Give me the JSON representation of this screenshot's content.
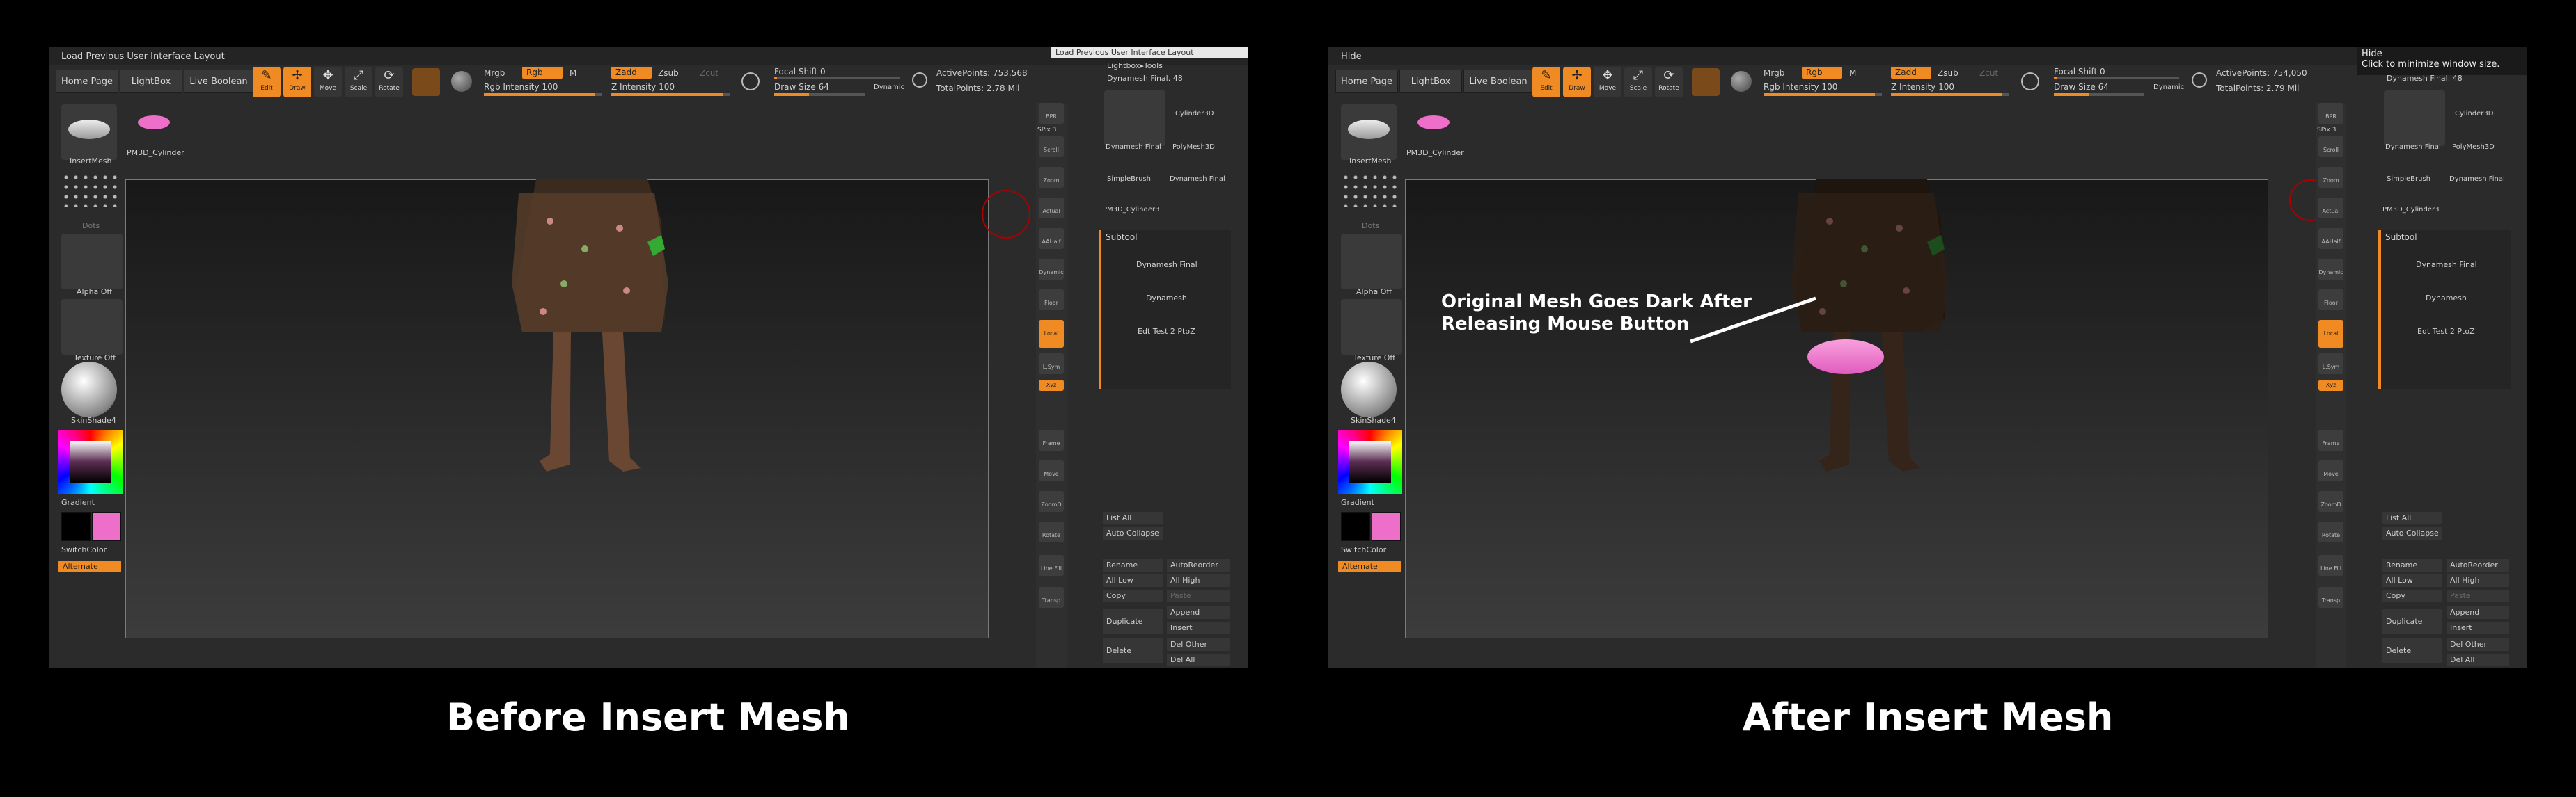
{
  "captions": {
    "before": "Before Insert Mesh",
    "after": "After Insert Mesh"
  },
  "annotation": {
    "line1": "Original Mesh Goes Dark After",
    "line2": "Releasing Mouse Button"
  },
  "before": {
    "menu_text": "Load Previous User Interface Layout",
    "popup_text": "Load Previous User Interface Layout",
    "tabs": [
      "Home Page",
      "LightBox",
      "Live Boolean"
    ],
    "tools": [
      "Edit",
      "Draw",
      "Move",
      "Scale",
      "Rotate"
    ],
    "mrgb": "Mrgb",
    "rgb": "Rgb",
    "m": "M",
    "zadd": "Zadd",
    "zsub": "Zsub",
    "zcut": "Zcut",
    "rgb_intensity": "Rgb Intensity 100",
    "z_intensity": "Z Intensity 100",
    "focal_shift": "Focal Shift 0",
    "draw_size": "Draw Size 64",
    "dynamic": "Dynamic",
    "active_points": "ActivePoints: 753,568",
    "total_points": "TotalPoints: 2.78 Mil",
    "insertmesh_label": "InsertMesh",
    "cylinder_label": "PM3D_Cylinder",
    "dots_label": "Dots",
    "alpha_off": "Alpha Off",
    "texture_off": "Texture Off",
    "material": "SkinShade4",
    "gradient": "Gradient",
    "switchcolor": "SwitchColor",
    "alternate": "Alternate",
    "lightbox_tools": "Lightbox▸Tools",
    "dynamesh_final_48": "Dynamesh Final. 48",
    "tool_thumbs": [
      "Dynamesh Final",
      "Cylinder3D",
      "PolyMesh3D",
      "SimpleBrush",
      "Dynamesh Final",
      "PM3D_Cylinder3"
    ],
    "subtool_title": "Subtool",
    "subtools": [
      "Dynamesh Final",
      "Dynamesh",
      "Edt Test 2 PtoZ"
    ],
    "list_all": "List All",
    "auto_collapse": "Auto Collapse",
    "buttons": [
      "Rename",
      "AutoReorder",
      "All Low",
      "All High",
      "Copy",
      "Paste",
      "Duplicate",
      "Append",
      "Insert",
      "Delete",
      "Del Other",
      "Del All"
    ],
    "spix": "SPix 3",
    "strip": [
      "BPR",
      "Scroll",
      "Zoom",
      "Actual",
      "AAHalf",
      "Dynamic Persp",
      "Floor",
      "Local",
      "L.Sym",
      "Xyz",
      "Frame",
      "Move",
      "ZoomD",
      "Rotate",
      "Line Fill PolyF",
      "Transp"
    ]
  },
  "after": {
    "menu_text": "Hide",
    "popup_title": "Hide",
    "popup_text": "Click to minimize window size.",
    "tabs": [
      "Home Page",
      "LightBox",
      "Live Boolean"
    ],
    "tools": [
      "Edit",
      "Draw",
      "Move",
      "Scale",
      "Rotate"
    ],
    "mrgb": "Mrgb",
    "rgb": "Rgb",
    "m": "M",
    "zadd": "Zadd",
    "zsub": "Zsub",
    "zcut": "Zcut",
    "rgb_intensity": "Rgb Intensity 100",
    "z_intensity": "Z Intensity 100",
    "focal_shift": "Focal Shift 0",
    "draw_size": "Draw Size 64",
    "dynamic": "Dynamic",
    "active_points": "ActivePoints: 754,050",
    "total_points": "TotalPoints: 2.79 Mil",
    "insertmesh_label": "InsertMesh",
    "cylinder_label": "PM3D_Cylinder",
    "dots_label": "Dots",
    "alpha_off": "Alpha Off",
    "texture_off": "Texture Off",
    "material": "SkinShade4",
    "gradient": "Gradient",
    "switchcolor": "SwitchColor",
    "alternate": "Alternate",
    "dynamesh_final_48": "Dynamesh Final. 48",
    "tool_thumbs": [
      "Dynamesh Final",
      "Cylinder3D",
      "PolyMesh3D",
      "SimpleBrush",
      "Dynamesh Final",
      "PM3D_Cylinder3"
    ],
    "subtool_title": "Subtool",
    "subtools": [
      "Dynamesh Final",
      "Dynamesh",
      "Edt Test 2 PtoZ"
    ],
    "list_all": "List All",
    "auto_collapse": "Auto Collapse",
    "buttons": [
      "Rename",
      "AutoReorder",
      "All Low",
      "All High",
      "Copy",
      "Paste",
      "Duplicate",
      "Append",
      "Insert",
      "Delete",
      "Del Other",
      "Del All"
    ],
    "spix": "SPix 3",
    "strip": [
      "BPR",
      "Scroll",
      "Zoom",
      "Actual",
      "AAHalf",
      "Dynamic Persp",
      "Floor",
      "Local",
      "L.Sym",
      "Xyz",
      "Frame",
      "Move",
      "ZoomD",
      "Rotate",
      "Line Fill PolyF",
      "Transp"
    ]
  },
  "colors": {
    "accent": "#ef8b22",
    "pink": "#ee6fc9",
    "panel": "#2b2b2b"
  }
}
